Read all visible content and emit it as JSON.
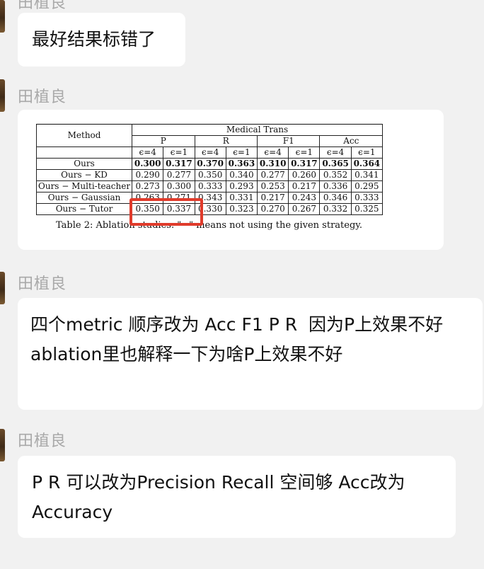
{
  "chat": {
    "messages": [
      {
        "sender": "田植良",
        "text": "最好结果标错了"
      },
      {
        "sender": "田植良",
        "type": "image"
      },
      {
        "sender": "田植良",
        "text": "四个metric 顺序改为 Acc F1 P R  因为P上效果不好\nablation里也解释一下为啥P上效果不好"
      },
      {
        "sender": "田植良",
        "text": "P R 可以改为Precision Recall 空间够 Acc改为\nAccuracy"
      }
    ]
  },
  "table_image": {
    "header": {
      "method": "Method",
      "group": "Medical Trans",
      "metrics": [
        "P",
        "R",
        "F1",
        "Acc"
      ],
      "eps": [
        "ϵ=4",
        "ϵ=1",
        "ϵ=4",
        "ϵ=1",
        "ϵ=4",
        "ϵ=1",
        "ϵ=4",
        "ϵ=1"
      ]
    },
    "rows": [
      {
        "method": "Ours",
        "values": [
          "0.300",
          "0.317",
          "0.370",
          "0.363",
          "0.310",
          "0.317",
          "0.365",
          "0.364"
        ],
        "bold": true
      },
      {
        "method": "Ours − KD",
        "values": [
          "0.290",
          "0.277",
          "0.350",
          "0.340",
          "0.277",
          "0.260",
          "0.352",
          "0.341"
        ]
      },
      {
        "method": "Ours − Multi-teacher",
        "values": [
          "0.273",
          "0.300",
          "0.333",
          "0.293",
          "0.253",
          "0.217",
          "0.336",
          "0.295"
        ]
      },
      {
        "method": "Ours − Gaussian",
        "values": [
          "0.263",
          "0.271",
          "0.343",
          "0.331",
          "0.217",
          "0.243",
          "0.346",
          "0.333"
        ]
      },
      {
        "method": "Ours − Tutor",
        "values": [
          "0.350",
          "0.337",
          "0.330",
          "0.323",
          "0.270",
          "0.267",
          "0.332",
          "0.325"
        ]
      }
    ],
    "caption": "Table 2: Ablation studies. \"−\" means not using the given strategy."
  },
  "colors": {
    "background": "#f1f1f1",
    "bubble": "#ffffff",
    "sender": "#a9a9a9",
    "highlight_box": "#e03b2b"
  }
}
